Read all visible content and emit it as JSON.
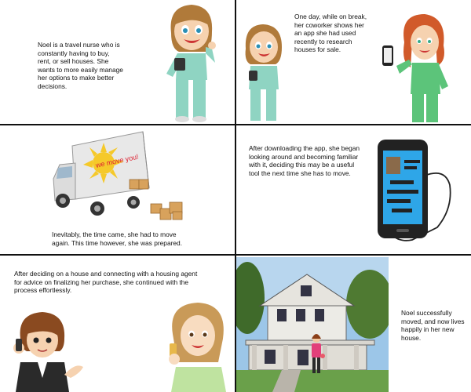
{
  "panels": [
    {
      "caption": "Noel is a travel nurse who is constantly having to buy, rent, or sell houses. She wants to more easily manage her options to make better decisions."
    },
    {
      "caption": "One day, while on break, her coworker shows her an app she had used recently to research houses for sale."
    },
    {
      "caption": "Inevitably, the time came, she had to move again. This time however, she was prepared."
    },
    {
      "caption": "After downloading the app, she began looking around and becoming familiar with it, deciding this may be a useful tool the next time she has to move."
    },
    {
      "caption": "After deciding on a house and connecting with a housing agent for advice on finalizing her purchase, she continued with the process effortlessly."
    },
    {
      "caption": "Noel successfully moved, and now lives happily in her new house."
    }
  ],
  "truck_sign": "we move you!",
  "icons": [
    "nurse-figure",
    "phone-icon",
    "moving-truck",
    "cardboard-boxes",
    "smartphone-app",
    "agent-figure",
    "house-photo"
  ]
}
